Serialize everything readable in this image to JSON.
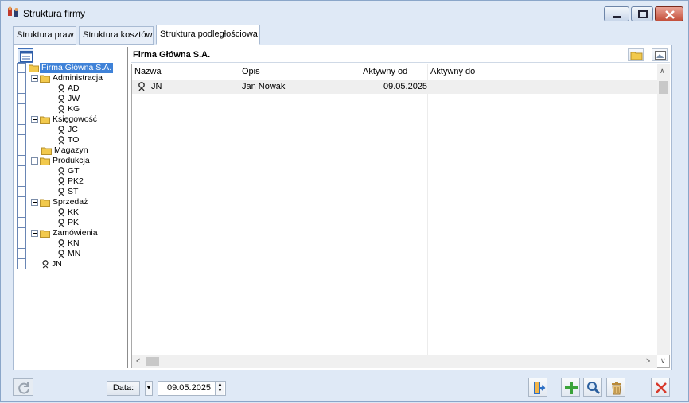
{
  "window": {
    "title": "Struktura firmy",
    "icon": "org-structure-icon"
  },
  "tabs": [
    {
      "label": "Struktura praw"
    },
    {
      "label": "Struktura kosztów"
    },
    {
      "label": "Struktura podległościowa",
      "active": true
    }
  ],
  "tree": {
    "items": [
      {
        "label": "Firma Główna S.A.",
        "type": "folder",
        "level": 0,
        "selected": true
      },
      {
        "label": "Administracja",
        "type": "folder",
        "level": 1,
        "expanded": true
      },
      {
        "label": "AD",
        "type": "person",
        "level": 2
      },
      {
        "label": "JW",
        "type": "person",
        "level": 2
      },
      {
        "label": "KG",
        "type": "person",
        "level": 2
      },
      {
        "label": "Księgowość",
        "type": "folder",
        "level": 1,
        "expanded": true
      },
      {
        "label": "JC",
        "type": "person",
        "level": 2
      },
      {
        "label": "TO",
        "type": "person",
        "level": 2
      },
      {
        "label": "Magazyn",
        "type": "folder",
        "level": 1
      },
      {
        "label": "Produkcja",
        "type": "folder",
        "level": 1,
        "expanded": true
      },
      {
        "label": "GT",
        "type": "person",
        "level": 2
      },
      {
        "label": "PK2",
        "type": "person",
        "level": 2
      },
      {
        "label": "ST",
        "type": "person",
        "level": 2
      },
      {
        "label": "Sprzedaż",
        "type": "folder",
        "level": 1,
        "expanded": true
      },
      {
        "label": "KK",
        "type": "person",
        "level": 2
      },
      {
        "label": "PK",
        "type": "person",
        "level": 2
      },
      {
        "label": "Zamówienia",
        "type": "folder",
        "level": 1,
        "expanded": true
      },
      {
        "label": "KN",
        "type": "person",
        "level": 2
      },
      {
        "label": "MN",
        "type": "person",
        "level": 2
      },
      {
        "label": "JN",
        "type": "person",
        "level": 1
      }
    ]
  },
  "right": {
    "heading": "Firma Główna S.A.",
    "columns": [
      "Nazwa",
      "Opis",
      "Aktywny od",
      "Aktywny do"
    ],
    "rows": [
      {
        "icon": "person-icon",
        "name": "JN",
        "desc": "Jan Nowak",
        "from": "09.05.2025",
        "to": ""
      }
    ]
  },
  "bottom": {
    "date_label": "Data:",
    "date_value": "09.05.2025"
  },
  "colors": {
    "accent": "#3f82d8",
    "window_bg": "#dfe9f6",
    "folder": "#f2c94c",
    "add_green": "#3aa33a",
    "delete_red": "#d8392b"
  }
}
